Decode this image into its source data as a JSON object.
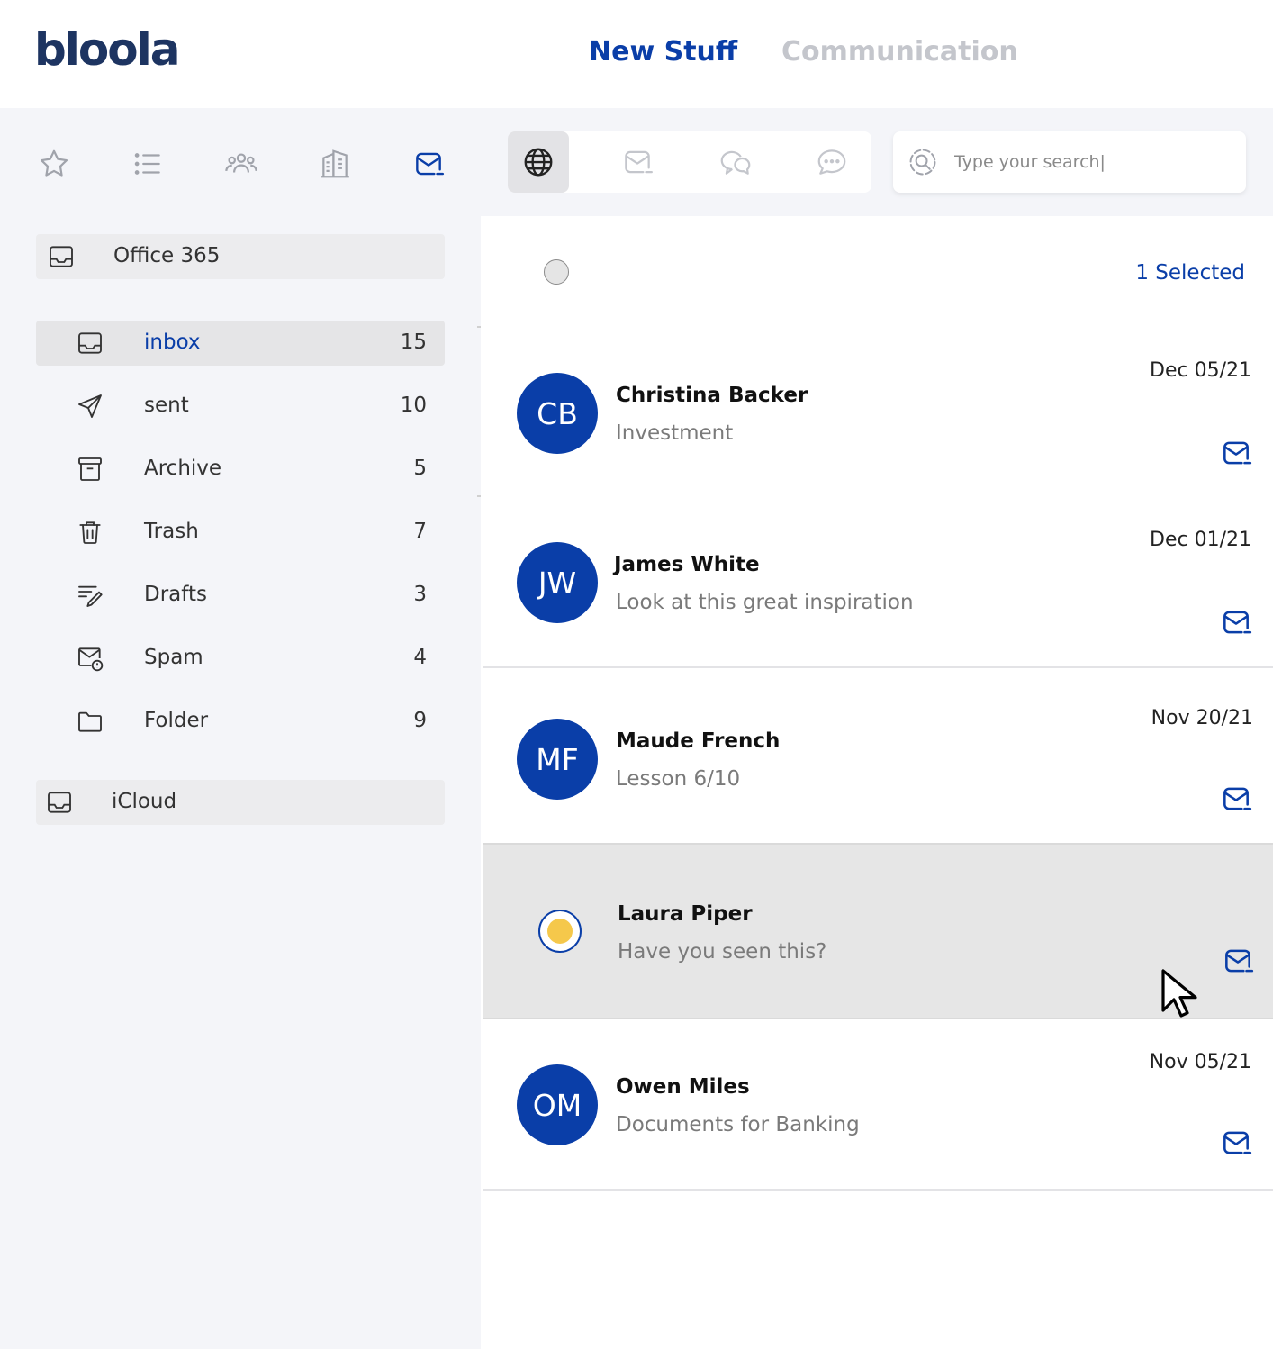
{
  "brand": {
    "name": "bloola"
  },
  "top_tabs": [
    {
      "label": "New Stuff",
      "active": true
    },
    {
      "label": "Communication",
      "active": false
    }
  ],
  "sidebar": {
    "nav_icons": [
      "star-icon",
      "list-icon",
      "people-icon",
      "buildings-icon",
      "mail-icon"
    ],
    "accounts": [
      {
        "label": "Office 365"
      },
      {
        "label": "iCloud"
      }
    ],
    "folders": [
      {
        "label": "inbox",
        "count": "15",
        "icon": "inbox-icon",
        "active": true
      },
      {
        "label": "sent",
        "count": "10",
        "icon": "send-icon"
      },
      {
        "label": "Archive",
        "count": "5",
        "icon": "archive-icon"
      },
      {
        "label": "Trash",
        "count": "7",
        "icon": "trash-icon"
      },
      {
        "label": "Drafts",
        "count": "3",
        "icon": "drafts-icon"
      },
      {
        "label": "Spam",
        "count": "4",
        "icon": "spam-icon"
      },
      {
        "label": "Folder",
        "count": "9",
        "icon": "folder-icon"
      }
    ]
  },
  "filters": [
    "globe-icon",
    "mail-icon",
    "chat-bubbles-icon",
    "message-icon"
  ],
  "search": {
    "placeholder": "Type your search|"
  },
  "selection": {
    "label": "1 Selected"
  },
  "messages": [
    {
      "initials": "CB",
      "sender": "Christina Backer",
      "subject": "Investment",
      "date": "Dec 05/21"
    },
    {
      "initials": "JW",
      "sender": "James White",
      "subject": "Look at this great inspiration",
      "date": "Dec 01/21"
    },
    {
      "initials": "MF",
      "sender": "Maude French",
      "subject": "Lesson 6/10",
      "date": "Nov 20/21"
    },
    {
      "initials": "",
      "sender": "Laura Piper",
      "subject": "Have you seen this?",
      "date": "",
      "selected": true
    },
    {
      "initials": "OM",
      "sender": "Owen Miles",
      "subject": "Documents for Banking",
      "date": "Nov 05/21"
    }
  ],
  "colors": {
    "accent": "#0a3ea8",
    "logo": "#1d3461",
    "sidebar_bg": "#f4f5f9",
    "selected_dot": "#f5c84b"
  }
}
